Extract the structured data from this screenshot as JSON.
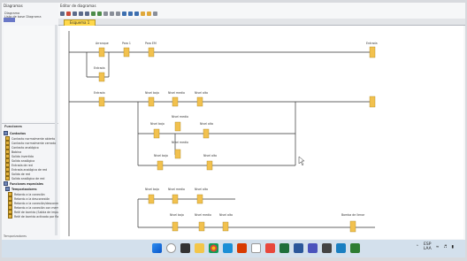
{
  "left": {
    "title": "Diagramas",
    "tree": [
      "Diagrama",
      "Lista de base Diagrama"
    ],
    "functions_header": "Funciones",
    "groups": [
      {
        "label": "Contactos",
        "items": [
          "Contacto normalmente abierto",
          "Contacto normalmente cerrado",
          "Contacto analógico",
          "Bobina",
          "Salida invertida",
          "Salida analógica",
          "Entrada de red",
          "Entrada analógica de red",
          "Salida de red",
          "Salida analógica de red"
        ]
      },
      {
        "label": "Funciones especiales",
        "items": [
          "Temporizadores",
          "Retardo a la conexión",
          "Retardo a la desconexión",
          "Retardo a la conexión/desconexión",
          "Retardo a la conexión con memoria",
          "Relé de barrido (Salida de impulsos)",
          "Relé de barrido activado por flanco"
        ]
      }
    ],
    "bottom_label": "Temporizadores"
  },
  "editor": {
    "title": "Editor de diagramas",
    "tab": "Esquema 1"
  },
  "ladder": {
    "rungs": [
      {
        "contacts": [
          "Arranque",
          "Paro 1",
          "Paro EM"
        ],
        "coil": "Entrada"
      },
      {
        "contacts": [
          "Entrada"
        ],
        "coil": ""
      },
      {
        "contacts": [
          "Entrada",
          "Nivel bajo",
          "Nivel medio",
          "Nivel alto"
        ],
        "coil": ""
      },
      {
        "contacts": [
          "Nivel bajo",
          "Nivel medio",
          "Nivel alto"
        ],
        "coil": ""
      },
      {
        "contacts": [
          "Nivel bajo",
          "Nivel medio",
          "Nivel alto"
        ],
        "coil": ""
      },
      {
        "contacts": [
          "Nivel bajo",
          "Nivel medio",
          "Nivel alto"
        ],
        "coil": ""
      },
      {
        "contacts": [
          "Nivel bajo",
          "Nivel medio",
          "Nivel alto"
        ],
        "coil": "Bomba de llenar"
      }
    ]
  },
  "taskbar": {
    "lang": "ESP",
    "region": "LAA",
    "time": "",
    "date": ""
  }
}
